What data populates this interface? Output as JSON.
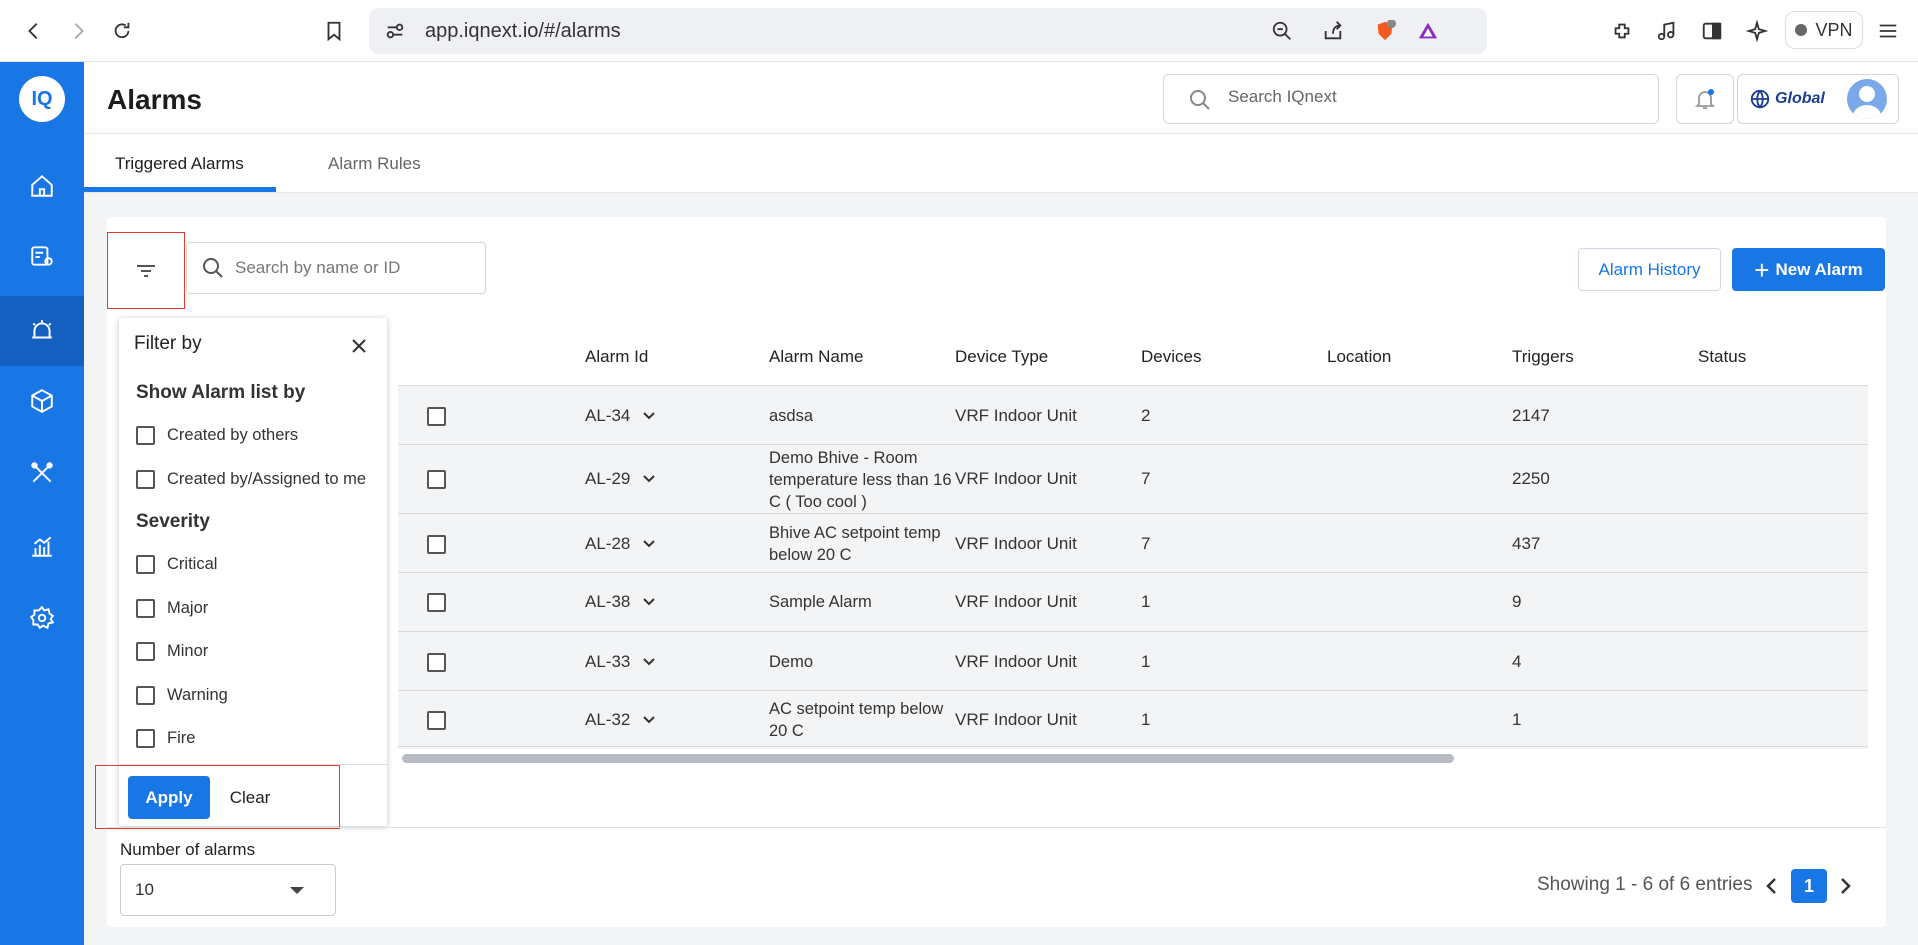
{
  "browser": {
    "url": "app.iqnext.io/#/alarms",
    "vpn_label": "VPN",
    "brave_badge": "1"
  },
  "sidebar": {
    "logo": "IQ",
    "items": [
      {
        "icon": "home-icon"
      },
      {
        "icon": "device-settings-icon"
      },
      {
        "icon": "alarm-icon",
        "active": true
      },
      {
        "icon": "cube-icon"
      },
      {
        "icon": "tools-icon"
      },
      {
        "icon": "analytics-icon"
      },
      {
        "icon": "settings-icon"
      }
    ]
  },
  "header": {
    "title": "Alarms",
    "search_placeholder": "Search IQnext",
    "brand": "Global"
  },
  "tabs": [
    {
      "label": "Triggered Alarms",
      "active": true
    },
    {
      "label": "Alarm Rules",
      "active": false
    }
  ],
  "toolbar": {
    "search_placeholder": "Search by name or ID",
    "history_label": "Alarm History",
    "new_label": "New Alarm"
  },
  "table": {
    "columns": [
      "Alarm Id",
      "Alarm Name",
      "Device Type",
      "Devices",
      "Location",
      "Triggers",
      "Status"
    ],
    "rows": [
      {
        "id": "AL-34",
        "name": "asdsa",
        "device_type": "VRF Indoor Unit",
        "devices": "2",
        "location": "",
        "triggers": "2147"
      },
      {
        "id": "AL-29",
        "name": "Demo Bhive - Room temperature less than 16 C ( Too cool )",
        "device_type": "VRF Indoor Unit",
        "devices": "7",
        "location": "",
        "triggers": "2250"
      },
      {
        "id": "AL-28",
        "name": "Bhive AC setpoint temp below 20 C",
        "device_type": "VRF Indoor Unit",
        "devices": "7",
        "location": "",
        "triggers": "437"
      },
      {
        "id": "AL-38",
        "name": "Sample Alarm",
        "device_type": "VRF Indoor Unit",
        "devices": "1",
        "location": "",
        "triggers": "9"
      },
      {
        "id": "AL-33",
        "name": "Demo",
        "device_type": "VRF Indoor Unit",
        "devices": "1",
        "location": "",
        "triggers": "4"
      },
      {
        "id": "AL-32",
        "name": "AC setpoint temp below 20 C",
        "device_type": "VRF Indoor Unit",
        "devices": "1",
        "location": "",
        "triggers": "1"
      }
    ]
  },
  "filter": {
    "title": "Filter by",
    "section1": "Show Alarm list by",
    "section1_options": [
      "Created by others",
      "Created by/Assigned to me"
    ],
    "section2": "Severity",
    "section2_options": [
      "Critical",
      "Major",
      "Minor",
      "Warning",
      "Fire"
    ],
    "apply_label": "Apply",
    "clear_label": "Clear"
  },
  "footer": {
    "count_label": "Number of alarms",
    "count_value": "10",
    "entries_text": "Showing 1 - 6 of 6 entries",
    "current_page": "1"
  },
  "colors": {
    "primary": "#1976e5",
    "highlight": "#e53935"
  }
}
